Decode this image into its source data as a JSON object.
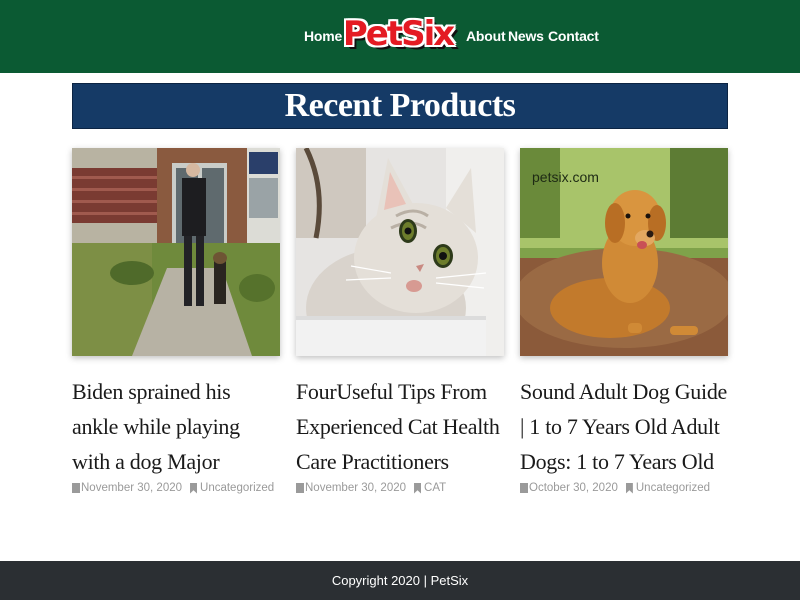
{
  "header": {
    "nav": {
      "home": "Home",
      "about": "About",
      "news": "News",
      "contact": "Contact"
    },
    "logo_text": "PetSix",
    "bg_color": "#0b5a33"
  },
  "section": {
    "title": "Recent Products",
    "bg_color": "#153a66"
  },
  "posts": [
    {
      "title": "Biden sprained his ankle while playing with a dog Major",
      "date": "November 30, 2020",
      "category": "Uncategorized"
    },
    {
      "title": "FourUseful Tips From Experienced Cat Health Care Practitioners",
      "date": "November 30, 2020",
      "category": "CAT"
    },
    {
      "title": "Sound Adult Dog Guide | 1 to 7 Years Old Adult Dogs: 1 to 7 Years Old",
      "date": "October 30, 2020",
      "category": "Uncategorized",
      "image_watermark": "petsix.com"
    }
  ],
  "icons": {
    "date": "calendar-icon",
    "category": "bookmark-icon"
  },
  "footer": {
    "copyright": "Copyright 2020 | PetSix",
    "bg_color": "#2b2f33"
  }
}
